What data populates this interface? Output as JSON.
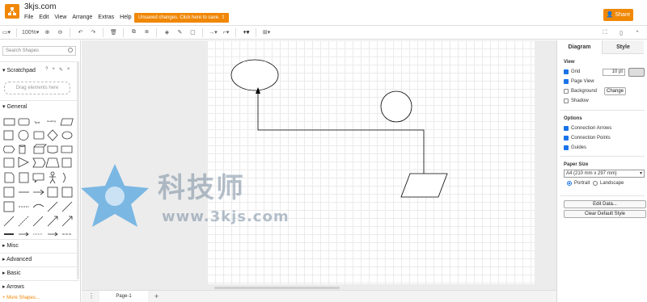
{
  "app": {
    "title": "3kjs.com",
    "menu": [
      "File",
      "Edit",
      "View",
      "Arrange",
      "Extras",
      "Help"
    ],
    "unsaved_notice": "Unsaved changes. Click here to save.",
    "share_label": "Share",
    "accent": "#f08705"
  },
  "toolbar": {
    "zoom": "100%"
  },
  "sidebar": {
    "search_placeholder": "Search Shapes",
    "scratchpad_label": "Scratchpad",
    "scratchpad_tools": [
      "?",
      "+",
      "✎",
      "×"
    ],
    "drag_hint": "Drag elements here",
    "sections": [
      "General",
      "Misc",
      "Advanced",
      "Basic",
      "Arrows"
    ],
    "more_shapes": "+ More Shapes..."
  },
  "canvas": {
    "page_tab": "Page-1"
  },
  "format_panel": {
    "tabs": [
      "Diagram",
      "Style"
    ],
    "view_label": "View",
    "grid_label": "Grid",
    "grid_size": "10 pt",
    "page_view_label": "Page View",
    "background_label": "Background",
    "change_label": "Change",
    "shadow_label": "Shadow",
    "options_label": "Options",
    "connection_arrows_label": "Connection Arrows",
    "connection_points_label": "Connection Points",
    "guides_label": "Guides",
    "paper_size_label": "Paper Size",
    "paper_size_value": "A4 (210 mm x 297 mm)",
    "portrait_label": "Portrait",
    "landscape_label": "Landscape",
    "edit_data_label": "Edit Data...",
    "clear_default_style_label": "Clear Default Style"
  },
  "watermark": {
    "text": "科技师",
    "url": "www.3kjs.com"
  }
}
